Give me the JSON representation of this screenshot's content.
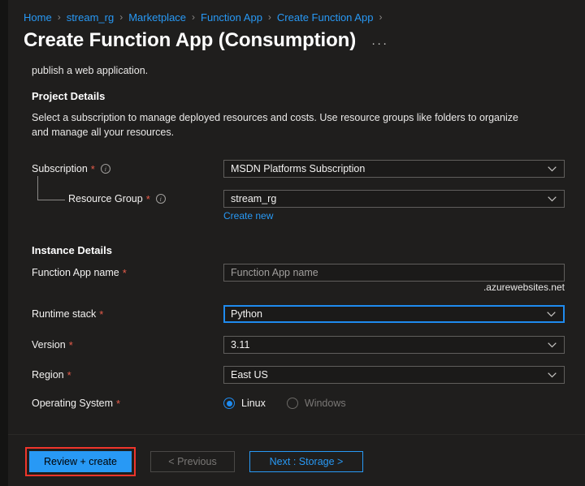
{
  "breadcrumb": {
    "separator": "›",
    "items": [
      {
        "label": "Home"
      },
      {
        "label": "stream_rg"
      },
      {
        "label": "Marketplace"
      },
      {
        "label": "Function App"
      },
      {
        "label": "Create Function App"
      }
    ]
  },
  "header": {
    "title": "Create Function App (Consumption)",
    "more_menu": "···"
  },
  "intro_text": "publish a web application.",
  "project_details": {
    "heading": "Project Details",
    "description": "Select a subscription to manage deployed resources and costs. Use resource groups like folders to organize and manage all your resources.",
    "subscription": {
      "label": "Subscription",
      "required_marker": "*",
      "info": "i",
      "value": "MSDN Platforms Subscription"
    },
    "resource_group": {
      "label": "Resource Group",
      "required_marker": "*",
      "info": "i",
      "value": "stream_rg",
      "create_new_link": "Create new"
    }
  },
  "instance_details": {
    "heading": "Instance Details",
    "function_app_name": {
      "label": "Function App name",
      "required_marker": "*",
      "value": "",
      "placeholder": "Function App name",
      "suffix": ".azurewebsites.net"
    },
    "runtime_stack": {
      "label": "Runtime stack",
      "required_marker": "*",
      "value": "Python",
      "focused": true
    },
    "version": {
      "label": "Version",
      "required_marker": "*",
      "value": "3.11"
    },
    "region": {
      "label": "Region",
      "required_marker": "*",
      "value": "East US"
    },
    "operating_system": {
      "label": "Operating System",
      "required_marker": "*",
      "options": [
        {
          "label": "Linux",
          "selected": true,
          "disabled": false
        },
        {
          "label": "Windows",
          "selected": false,
          "disabled": true
        }
      ]
    }
  },
  "footer": {
    "review_create": "Review + create",
    "previous": "< Previous",
    "next": "Next : Storage >"
  },
  "colors": {
    "page_background": "#1f1e1d",
    "accent_blue": "#2899f5",
    "focus_blue": "#1f8bef",
    "required_red": "#e85c4a",
    "highlight_red": "#f0352b",
    "field_border": "#605e5c",
    "text_primary": "#f3f2f1",
    "text_disabled": "#7a7876"
  }
}
